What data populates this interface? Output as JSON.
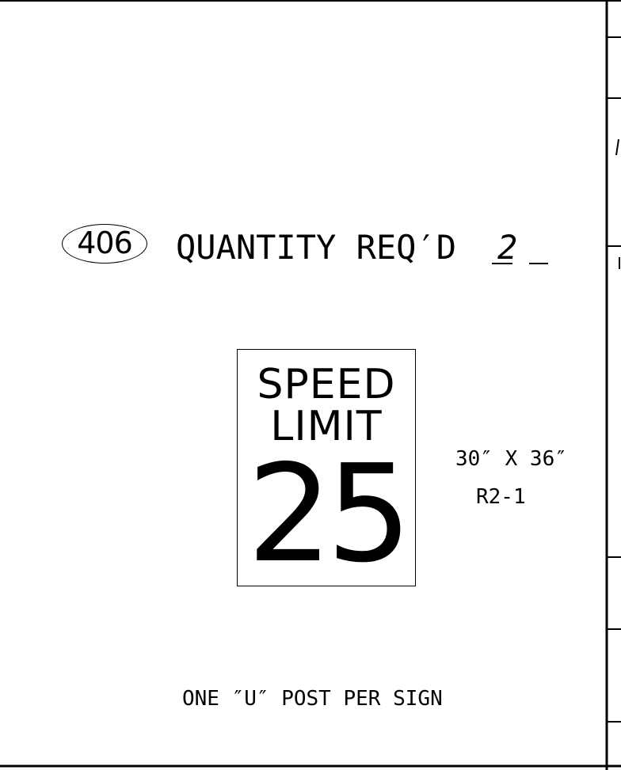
{
  "callout": {
    "number": "406"
  },
  "quantity": {
    "label": "QUANTITY REQ′D",
    "value": "2"
  },
  "sign": {
    "line1": "SPEED",
    "line2": "LIMIT",
    "number": "25",
    "size": "30″ X 36″",
    "code": "R2-1"
  },
  "note": "ONE ″U″ POST PER SIGN"
}
